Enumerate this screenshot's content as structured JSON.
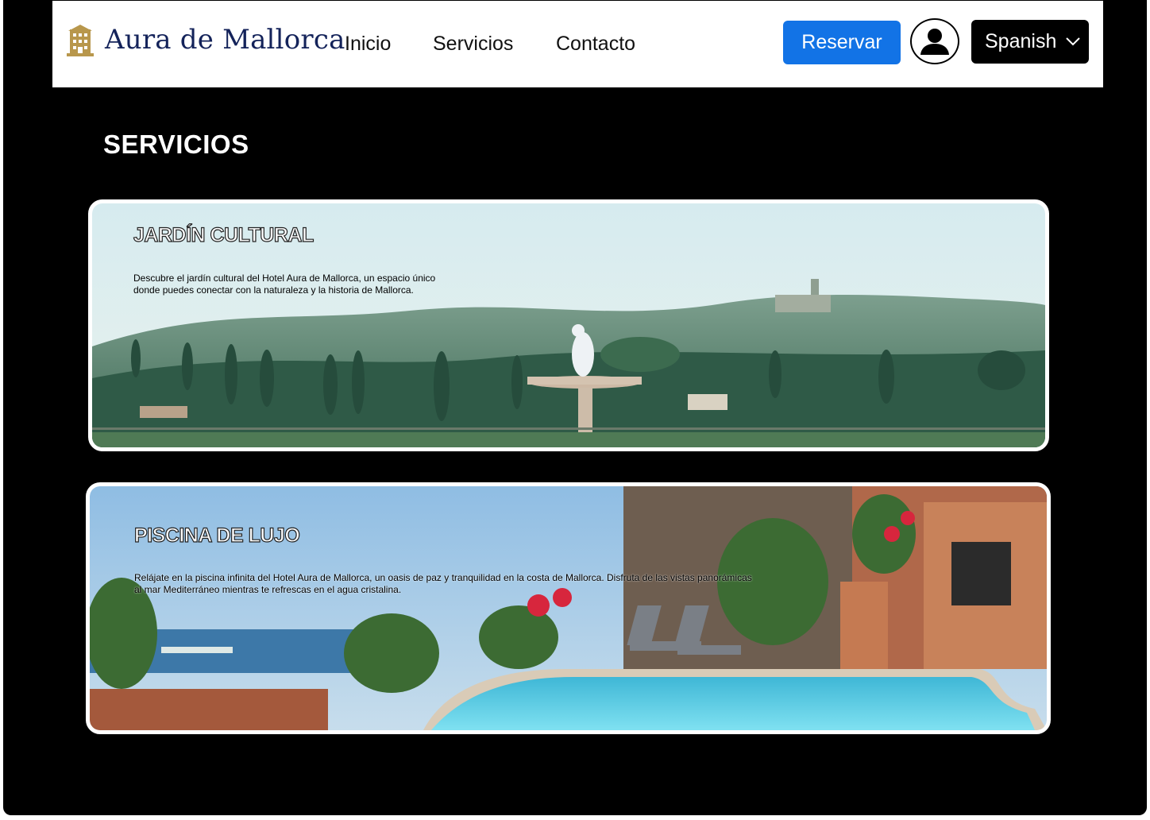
{
  "header": {
    "brand": "Aura de Mallorca",
    "nav": [
      "Inicio",
      "Servicios",
      "Contacto"
    ],
    "reserve_label": "Reservar",
    "language": "Spanish"
  },
  "page": {
    "title": "SERVICIOS"
  },
  "services": [
    {
      "title": "JARDÍN CULTURAL",
      "description_line1": "Descubre el jardín cultural del Hotel Aura de Mallorca, un espacio único",
      "description_line2": "donde puedes conectar con la naturaleza y la historia de Mallorca."
    },
    {
      "title": "PISCINA DE LUJO",
      "description_line1": "Relájate en la piscina infinita del Hotel Aura de Mallorca, un oasis de paz y tranquilidad en la costa de Mallorca. Disfruta de las vistas panorámicas",
      "description_line2": "al mar Mediterráneo mientras te refrescas en el agua cristalina."
    }
  ],
  "colors": {
    "accent": "#1273e6",
    "brand": "#14235a",
    "background": "#000000",
    "hotel_icon": "#b8974c"
  }
}
